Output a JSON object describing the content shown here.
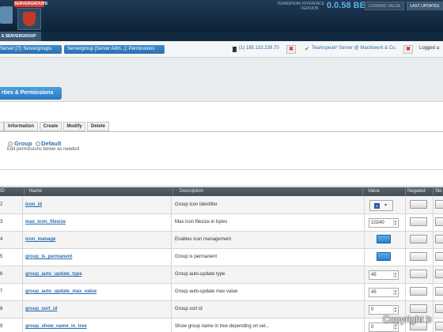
{
  "header": {
    "logo_label": "SERVERGROUPS",
    "software_title": "TEAMSPEAK INTERFACE",
    "software_sub": "VERSION",
    "version": "0.0.58 BE",
    "changes_label": "LOOKING VALUE",
    "updates_label": "LAST UPDATES",
    "tab_label": "E SERVERGROUP"
  },
  "breadcrumb": {
    "item1": "Server [7]: Servergroups",
    "item2": "Servergroup [Server Adm...]: Permissions",
    "ip": "(1) 185.133.239.70",
    "server_name": "Teamspeak³ Server @ Machtwerk & Co.",
    "logged": "Logged a",
    "close_glyph": "✖",
    "check_glyph": "✔"
  },
  "section": {
    "title": "rties & Permissions"
  },
  "tabs": [
    "",
    "Information",
    "Create",
    "Modify",
    "Delete"
  ],
  "groups": {
    "group_label": "Group",
    "default_label": "Default",
    "hint": "Edit permissions below as needed"
  },
  "table": {
    "headers": {
      "id": "ID",
      "name": "Name",
      "description": "Description",
      "value": "Value",
      "negated": "Negated",
      "skip": "Ski"
    },
    "rows": [
      {
        "id": "2",
        "name": "icon_id",
        "description": "Group icon identifier",
        "value_type": "icon",
        "value": ""
      },
      {
        "id": "3",
        "name": "max_icon_filesize",
        "description": "Max icon filesize in bytes",
        "value_type": "number",
        "value": "10240"
      },
      {
        "id": "4",
        "name": "icon_manage",
        "description": "Enables icon management",
        "value_type": "toggle",
        "value": ""
      },
      {
        "id": "5",
        "name": "group_is_permanent",
        "description": "Group is permanent",
        "value_type": "toggle",
        "value": ""
      },
      {
        "id": "6",
        "name": "group_auto_update_type",
        "description": "Group auto-update type",
        "value_type": "number",
        "value": "45"
      },
      {
        "id": "7",
        "name": "group_auto_update_max_value",
        "description": "Group auto-update max value",
        "value_type": "number",
        "value": "45"
      },
      {
        "id": "8",
        "name": "group_sort_id",
        "description": "Group sort id",
        "value_type": "number",
        "value": "0"
      },
      {
        "id": "9",
        "name": "group_show_name_in_tree",
        "description": "Show group name in tree depending on sel...",
        "value_type": "number",
        "value": "0"
      }
    ]
  },
  "watermark": "Copyright b"
}
